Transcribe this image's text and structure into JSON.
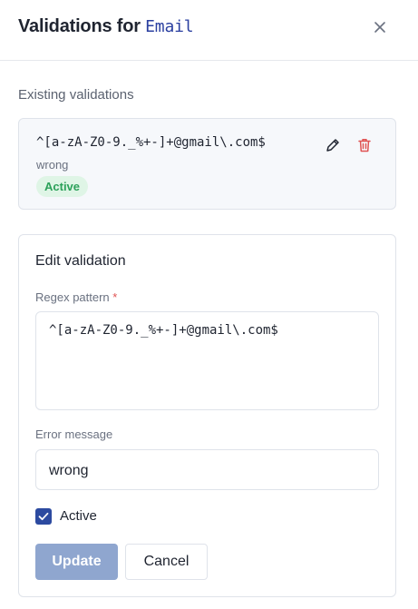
{
  "header": {
    "title_prefix": "Validations for",
    "field_name": "Email",
    "close_icon": "close-icon"
  },
  "existing": {
    "label": "Existing validations",
    "items": [
      {
        "pattern": "^[a-zA-Z0-9._%+-]+@gmail\\.com$",
        "message": "wrong",
        "status": "Active",
        "icons": [
          "pencil-icon",
          "trash-icon"
        ]
      }
    ]
  },
  "edit": {
    "title": "Edit validation",
    "regex_label": "Regex pattern",
    "required_mark": "*",
    "regex_value": "^[a-zA-Z0-9._%+-]+@gmail\\.com$",
    "error_label": "Error message",
    "error_value": "wrong",
    "active_label": "Active",
    "active_checked": true,
    "update_label": "Update",
    "cancel_label": "Cancel"
  },
  "colors": {
    "accent": "#2c4aa0",
    "badge_bg": "#dff5e6",
    "badge_text": "#2ca15a",
    "delete": "#e05252",
    "update_disabled": "#8fa6cf"
  }
}
